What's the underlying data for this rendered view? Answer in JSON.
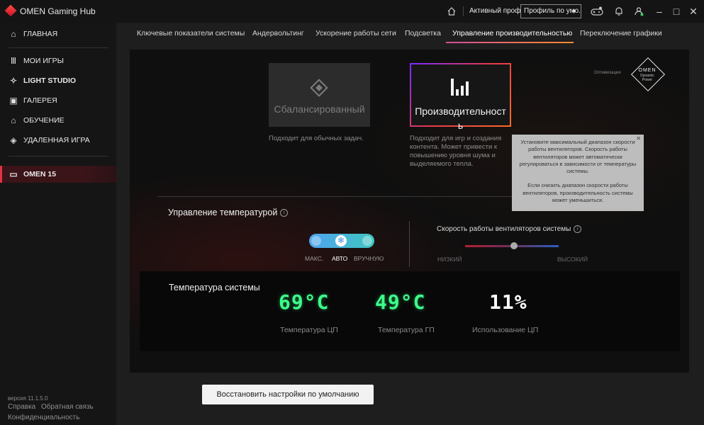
{
  "app": {
    "title": "OMEN Gaming Hub"
  },
  "titlebar": {
    "active_profile_label": "Активный профиль",
    "profile_value": "Профиль по умо...",
    "icons": [
      "home-icon",
      "gamepad-icon",
      "bell-icon",
      "user-icon",
      "minimize-icon",
      "maximize-icon",
      "close-icon"
    ]
  },
  "sidebar": {
    "items": [
      {
        "label": "ГЛАВНАЯ",
        "icon": "home-icon"
      },
      {
        "label": "МОИ ИГРЫ",
        "icon": "library-icon"
      },
      {
        "label": "LIGHT STUDIO",
        "icon": "sparkle-icon"
      },
      {
        "label": "ГАЛЕРЕЯ",
        "icon": "gallery-icon"
      },
      {
        "label": "ОБУЧЕНИЕ",
        "icon": "graduation-icon"
      },
      {
        "label": "УДАЛЕННАЯ ИГРА",
        "icon": "remote-play-icon"
      },
      {
        "label": "OMEN 15",
        "icon": "laptop-icon"
      }
    ],
    "version": "версия  11.1.5.0",
    "links": {
      "help": "Справка",
      "feedback": "Обратная связь",
      "privacy": "Конфиденциальность"
    }
  },
  "tabs": [
    "Ключевые показатели системы",
    "Андервольтинг",
    "Ускорение работы сети",
    "Подсветка",
    "Управление производительностью",
    "Переключение графики"
  ],
  "modes": {
    "balanced": {
      "name": "Сбалансированный",
      "desc": "Подходит для обычных задач."
    },
    "performance": {
      "name": "Производительность",
      "desc_lines": [
        "Подходит для игр и создания",
        "контента. Может привести к",
        "повышению уровня шума и",
        "выделяемого тепла."
      ]
    },
    "optimization_label": "Оптимизация",
    "badge": {
      "brand": "OMEN",
      "line1": "Dynamic",
      "line2": "Power"
    }
  },
  "tooltip": {
    "p1": "Установите максимальный диапазон скорости работы вентиляторов. Скорость работы вентиляторов может автоматически регулироваться в зависимости от температуры системы.",
    "p2": "Если снизить диапазон скорости работы вентиляторов, производительность системы может уменьшиться."
  },
  "thermal": {
    "title": "Управление температурой",
    "options": [
      "МАКС.",
      "АВТО",
      "ВРУЧНУЮ"
    ],
    "selected": "АВТО"
  },
  "fan": {
    "title": "Скорость работы вентиляторов системы",
    "low": "НИЗКИЙ",
    "high": "ВЫСОКИЙ",
    "level": 0.52
  },
  "system_temp": {
    "title": "Температура системы",
    "cpu_temp": "69°C",
    "gpu_temp": "49°C",
    "cpu_usage": "11%",
    "cpu_temp_label": "Температура ЦП",
    "gpu_temp_label": "Температура ГП",
    "cpu_usage_label": "Использование ЦП"
  },
  "restore_button": "Восстановить настройки по умолчанию",
  "colors": {
    "accent_red": "#e03344",
    "temp_green": "#3cff8a",
    "tab_underline_start": "#d34d9a",
    "tab_underline_end": "#ff8c2a"
  }
}
